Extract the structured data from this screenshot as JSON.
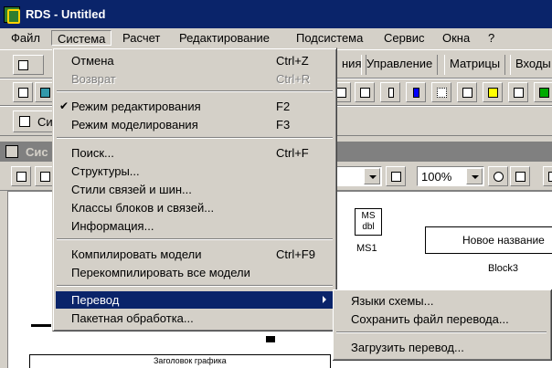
{
  "window": {
    "title": "RDS - Untitled"
  },
  "menubar": {
    "items": [
      {
        "label": "Файл"
      },
      {
        "label": "Система"
      },
      {
        "label": "Расчет"
      },
      {
        "label": "Редактирование"
      },
      {
        "label": "Подсистема"
      },
      {
        "label": "Сервис"
      },
      {
        "label": "Окна"
      },
      {
        "label": "?"
      }
    ]
  },
  "toolbar": {
    "tabs": [
      {
        "label": "ния"
      },
      {
        "label": "Управление"
      },
      {
        "label": "Матрицы"
      },
      {
        "label": "Входы"
      }
    ],
    "partial_button_label": "Си"
  },
  "subwindow": {
    "title": "Сис",
    "zoom": "100%"
  },
  "canvas": {
    "ms_block_text_line1": "MS",
    "ms_block_text_line2": "dbl",
    "ms_label": "MS1",
    "block3_text": "Новое название",
    "block3_label": "Block3",
    "graph_title": "Заголовок графика"
  },
  "system_menu": {
    "items": [
      {
        "label": "Отмена",
        "shortcut": "Ctrl+Z"
      },
      {
        "label": "Возврат",
        "shortcut": "Ctrl+R"
      },
      {
        "label": "Режим редактирования",
        "shortcut": "F2",
        "checked": true
      },
      {
        "label": "Режим моделирования",
        "shortcut": "F3"
      },
      {
        "label": "Поиск...",
        "shortcut": "Ctrl+F"
      },
      {
        "label": "Структуры..."
      },
      {
        "label": "Стили связей и шин..."
      },
      {
        "label": "Классы блоков и связей..."
      },
      {
        "label": "Информация..."
      },
      {
        "label": "Компилировать модели",
        "shortcut": "Ctrl+F9"
      },
      {
        "label": "Перекомпилировать все модели"
      },
      {
        "label": "Перевод"
      },
      {
        "label": "Пакетная обработка..."
      }
    ],
    "check_mark": "✔"
  },
  "translation_submenu": {
    "items": [
      {
        "label": "Языки схемы..."
      },
      {
        "label": "Сохранить файл перевода..."
      },
      {
        "label": "Загрузить перевод..."
      }
    ]
  },
  "colors": {
    "titlebar": "#0a246a",
    "highlight": "#0a246a",
    "face": "#d4d0c8"
  }
}
